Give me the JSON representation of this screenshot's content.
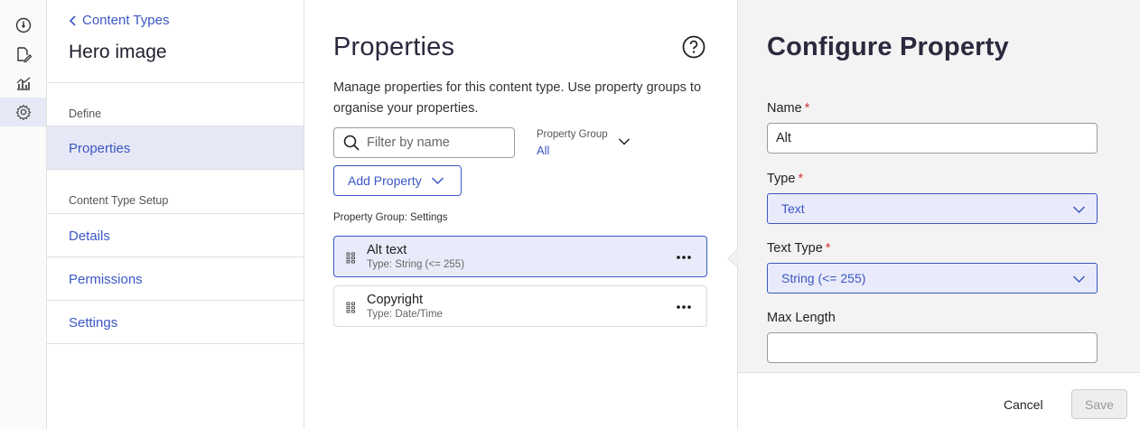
{
  "rail": {
    "icons": [
      "dashboard-icon",
      "content-edit-icon",
      "analytics-icon",
      "settings-gear-icon"
    ]
  },
  "nav": {
    "breadcrumb": "Content Types",
    "title": "Hero image",
    "section_define": "Define",
    "item_properties": "Properties",
    "section_setup": "Content Type Setup",
    "item_details": "Details",
    "item_permissions": "Permissions",
    "item_settings": "Settings"
  },
  "properties": {
    "title": "Properties",
    "description": "Manage properties for this content type. Use property groups to organise your properties.",
    "filter_placeholder": "Filter by name",
    "property_group_label": "Property Group",
    "property_group_value": "All",
    "add_button": "Add Property",
    "group_heading": "Property Group: Settings",
    "items": [
      {
        "name": "Alt text",
        "type": "Type: String (<= 255)",
        "selected": true
      },
      {
        "name": "Copyright",
        "type": "Type: Date/Time",
        "selected": false
      }
    ]
  },
  "configure": {
    "title": "Configure Property",
    "name_label": "Name",
    "name_value": "Alt",
    "type_label": "Type",
    "type_value": "Text",
    "text_type_label": "Text Type",
    "text_type_value": "String (<= 255)",
    "max_length_label": "Max Length",
    "max_length_value": "",
    "required_marker": "*",
    "cancel": "Cancel",
    "save": "Save"
  },
  "colors": {
    "accent": "#3b57c4",
    "selected_bg": "#e9ebfa",
    "required": "#d63434"
  }
}
